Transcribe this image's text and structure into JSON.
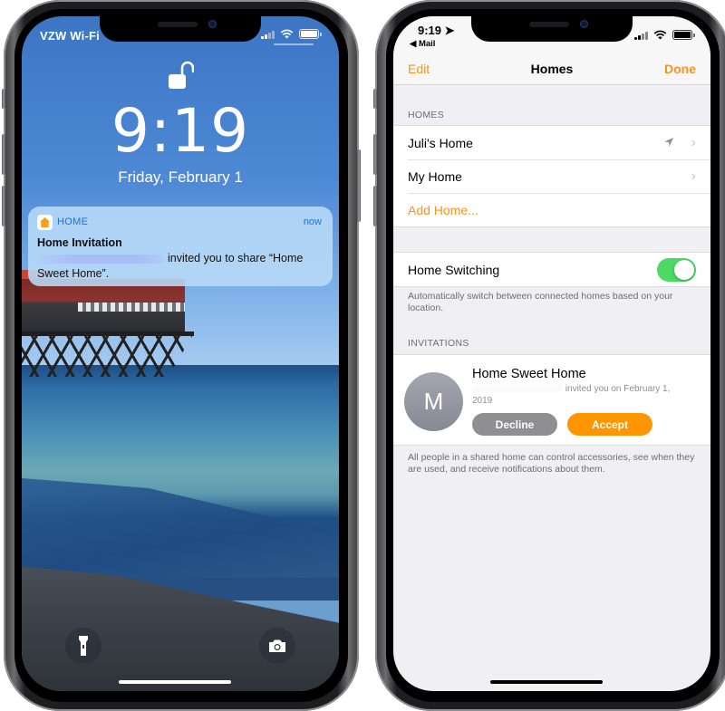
{
  "lock_screen": {
    "carrier": "VZW Wi-Fi",
    "time": "9:19",
    "date": "Friday, February 1",
    "notification": {
      "app": "HOME",
      "time": "now",
      "title": "Home Invitation",
      "body": "invited you to share “Home Sweet Home”."
    },
    "quick_actions": [
      "flashlight-icon",
      "camera-icon"
    ]
  },
  "homes_screen": {
    "status_time": "9:19",
    "back_label": "◀ Mail",
    "nav": {
      "edit_label": "Edit",
      "title": "Homes",
      "done_label": "Done"
    },
    "homes_section": {
      "header": "HOMES",
      "items": [
        {
          "label": "Juli's Home",
          "current_location": true
        },
        {
          "label": "My Home",
          "current_location": false
        }
      ],
      "add_label": "Add Home..."
    },
    "home_switching": {
      "label": "Home Switching",
      "enabled": true,
      "footer": "Automatically switch between connected homes based on your location."
    },
    "invitations_section": {
      "header": "INVITATIONS",
      "invite": {
        "avatar_initial": "M",
        "home_name": "Home Sweet Home",
        "detail": "invited you on February 1, 2019",
        "decline_label": "Decline",
        "accept_label": "Accept"
      },
      "footer": "All people in a shared home can control accessories, see when they are used, and receive notifications about them."
    }
  },
  "colors": {
    "accent_orange": "#f7941d",
    "accept_orange": "#ff9500",
    "toggle_green": "#4cd964",
    "decline_gray": "#8e8e93",
    "notification_blue": "#1a73d9"
  }
}
